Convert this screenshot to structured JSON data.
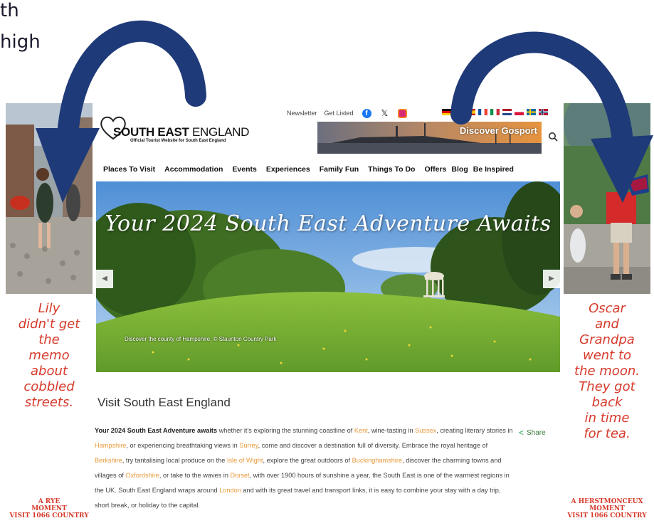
{
  "overlay": {
    "caption_line1": "th",
    "caption_line2": "high"
  },
  "left_ad": {
    "message": [
      "Lily",
      "didn't get",
      "the",
      "memo",
      "about",
      "cobbled",
      "streets."
    ],
    "footer": [
      "A RYE",
      "MOMENT",
      "VISIT 1066 COUNTRY"
    ]
  },
  "right_ad": {
    "message": [
      "Oscar",
      "and",
      "Grandpa",
      "went to",
      "the moon.",
      "They got",
      "back",
      "in time",
      "for tea."
    ],
    "footer": [
      "A HERSTMONCEUX",
      "MOMENT",
      "VISIT 1066 COUNTRY"
    ]
  },
  "site": {
    "logo_bold": "SOUTH EAST",
    "logo_light": "ENGLAND",
    "logo_sub": "Official Tourist Website for South East England",
    "top_links": {
      "newsletter": "Newsletter",
      "get_listed": "Get Listed"
    },
    "social_icons": [
      "facebook-icon",
      "x-icon",
      "instagram-icon"
    ],
    "banner_text": "Discover Gosport",
    "nav": [
      "Places To Visit",
      "Accommodation",
      "Events",
      "Experiences",
      "Family Fun",
      "Things To Do",
      "Offers",
      "Blog",
      "Be Inspired"
    ],
    "hero": {
      "title": "Your 2024 South East Adventure Awaits",
      "caption": "Discover the county of Hampshire, © Staunton Country Park",
      "prev": "◀",
      "next": "▶"
    },
    "section_title": "Visit South East England",
    "share_label": "Share",
    "intro": {
      "lead": "Your 2024 South East Adventure awaits",
      "p1": " whether it's exploring the stunning coastline of ",
      "kent": "Kent",
      "p2": ", wine-tasting in ",
      "sussex": "Sussex",
      "p3": ", creating literary stories in ",
      "hampshire": "Hampshire",
      "p4": ", or experiencing breathtaking views in ",
      "surrey": "Surrey",
      "p5": ", come and discover a destination full of diversity. Embrace the royal heritage of ",
      "berkshire": "Berkshire",
      "p6": ", try tantalising local produce on the ",
      "iow": "Isle of Wight",
      "p7": ", explore the great outdoors of ",
      "bucks": "Buckinghamshire",
      "p8": ", discover the charming towns and villages of ",
      "oxon": "Oxfordshire",
      "p9": ", or take to the waves in ",
      "dorset": "Dorset",
      "p10": ", with over 1900 hours of sunshine a year, the South East is one of the warmest regions in the UK. South East England wraps around ",
      "london": "London",
      "p11": " and with its great travel and transport links, it is easy to combine your stay with a day trip, short break, or holiday to the capital."
    }
  },
  "colors": {
    "arrow": "#1f3a78",
    "ad_red": "#d63a2b",
    "link_orange": "#e89a3c"
  }
}
